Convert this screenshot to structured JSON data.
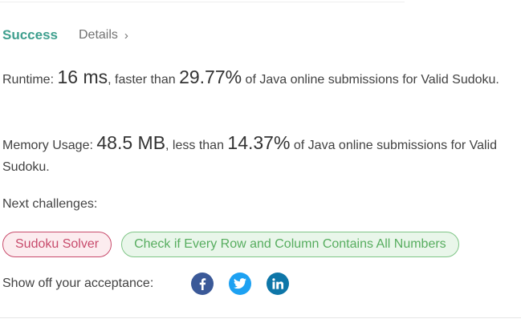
{
  "result": {
    "status": "Success",
    "details_label": "Details",
    "details_chevron": "›"
  },
  "runtime": {
    "label": "Runtime:",
    "value": "16 ms",
    "comparison": ", faster than",
    "percent": "29.77%",
    "suffix": "of Java online submissions for Valid Sudoku."
  },
  "memory": {
    "label": "Memory Usage:",
    "value": "48.5 MB",
    "comparison": ", less than",
    "percent": "14.37%",
    "suffix": "of Java online submissions for Valid Sudoku."
  },
  "next": {
    "title": "Next challenges:",
    "challenges": [
      {
        "label": "Sudoku Solver",
        "difficulty_color": "#c84b6c"
      },
      {
        "label": "Check if Every Row and Column Contains All Numbers",
        "difficulty_color": "#57ad5f"
      }
    ]
  },
  "share": {
    "label": "Show off your acceptance:",
    "icons": [
      {
        "name": "facebook-icon",
        "color": "#3b5998"
      },
      {
        "name": "twitter-icon",
        "color": "#1da1f2"
      },
      {
        "name": "linkedin-icon",
        "color": "#0e76a8"
      }
    ]
  },
  "colors": {
    "success": "#3e9f8e",
    "text": "#424242",
    "muted": "#727272"
  }
}
